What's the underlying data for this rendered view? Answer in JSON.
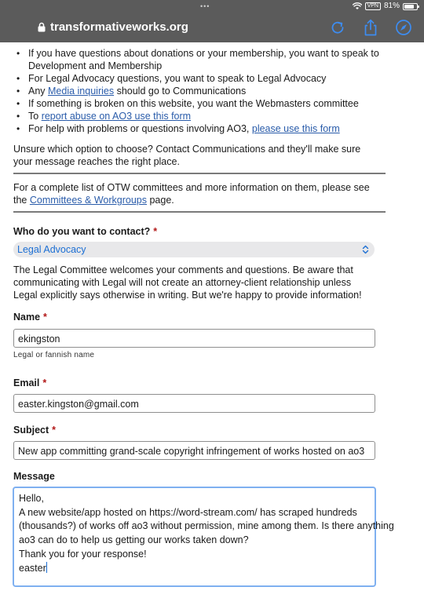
{
  "status_bar": {
    "dots": "•••",
    "vpn": "VPN",
    "battery": "81%",
    "battery_level": 0.81
  },
  "browser": {
    "host": "transformativeworks.org"
  },
  "bullets": [
    {
      "pre": "If you have questions about donations or your membership, you want to speak to Development and Membership",
      "link": "",
      "post": ""
    },
    {
      "pre": "For Legal Advocacy questions, you want to speak to Legal Advocacy",
      "link": "",
      "post": ""
    },
    {
      "pre": "Any ",
      "link": "Media inquiries",
      "post": " should go to Communications"
    },
    {
      "pre": "If something is broken on this website, you want the Webmasters committee",
      "link": "",
      "post": ""
    },
    {
      "pre": "To ",
      "link": "report abuse on AO3 use this form",
      "post": ""
    },
    {
      "pre": "For help with problems or questions involving AO3, ",
      "link": "please use this form",
      "post": ""
    }
  ],
  "unsure_text": "Unsure which option to choose? Contact Communications and they'll make sure your message reaches the right place.",
  "committees": {
    "pre": "For a complete list of OTW committees and more information on them, please see the ",
    "link": "Committees & Workgroups",
    "post": " page."
  },
  "form": {
    "required_mark": "*",
    "contact_label": "Who do you want to contact?",
    "contact_value": "Legal Advocacy",
    "legal_notice": "The Legal Committee welcomes your comments and questions. Be aware that communicating with Legal will not create an attorney-client relationship unless Legal explicitly says otherwise in writing. But we're happy to provide information!",
    "name_label": "Name",
    "name_value": "ekingston",
    "name_hint": "Legal or fannish name",
    "email_label": "Email",
    "email_value": "easter.kingston@gmail.com",
    "subject_label": "Subject",
    "subject_value": "New app committing grand-scale copyright infringement of works hosted on ao3",
    "message_label": "Message",
    "message_lines": [
      "Hello,",
      "A new website/app hosted on https://word-stream.com/ has scraped hundreds",
      "(thousands?) of works off ao3 without permission, mine among them. Is there anything",
      "ao3 can do to help us getting our works taken down?",
      "Thank you for your response!",
      "easter"
    ]
  },
  "colors": {
    "chrome": "#5b5b5b",
    "link": "#2a5caa",
    "select_text": "#1c6fd4",
    "required": "#b21818",
    "focus_border": "#7fb0f0"
  }
}
